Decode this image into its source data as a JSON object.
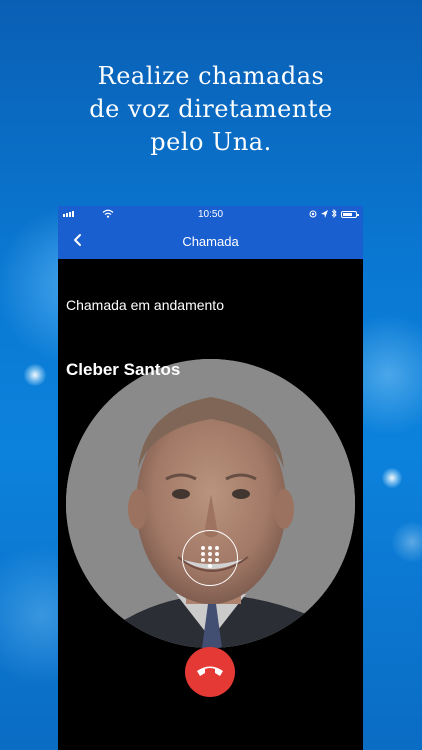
{
  "promo": {
    "line1": "Realize chamadas",
    "line2": "de voz diretamente",
    "line3": "pelo Una."
  },
  "status_bar": {
    "time": "10:50",
    "icons": [
      "signal-icon",
      "wifi-icon",
      "location-icon",
      "bluetooth-icon",
      "battery-icon"
    ]
  },
  "nav": {
    "back_icon": "chevron-left-icon",
    "title": "Chamada"
  },
  "call": {
    "status": "Chamada em andamento",
    "caller_name": "Cleber Santos",
    "keypad_icon": "dialpad-icon",
    "hangup_icon": "phone-hangup-icon"
  },
  "colors": {
    "background": "#0b78d2",
    "header": "#1a5fcf",
    "hangup": "#e53935"
  }
}
